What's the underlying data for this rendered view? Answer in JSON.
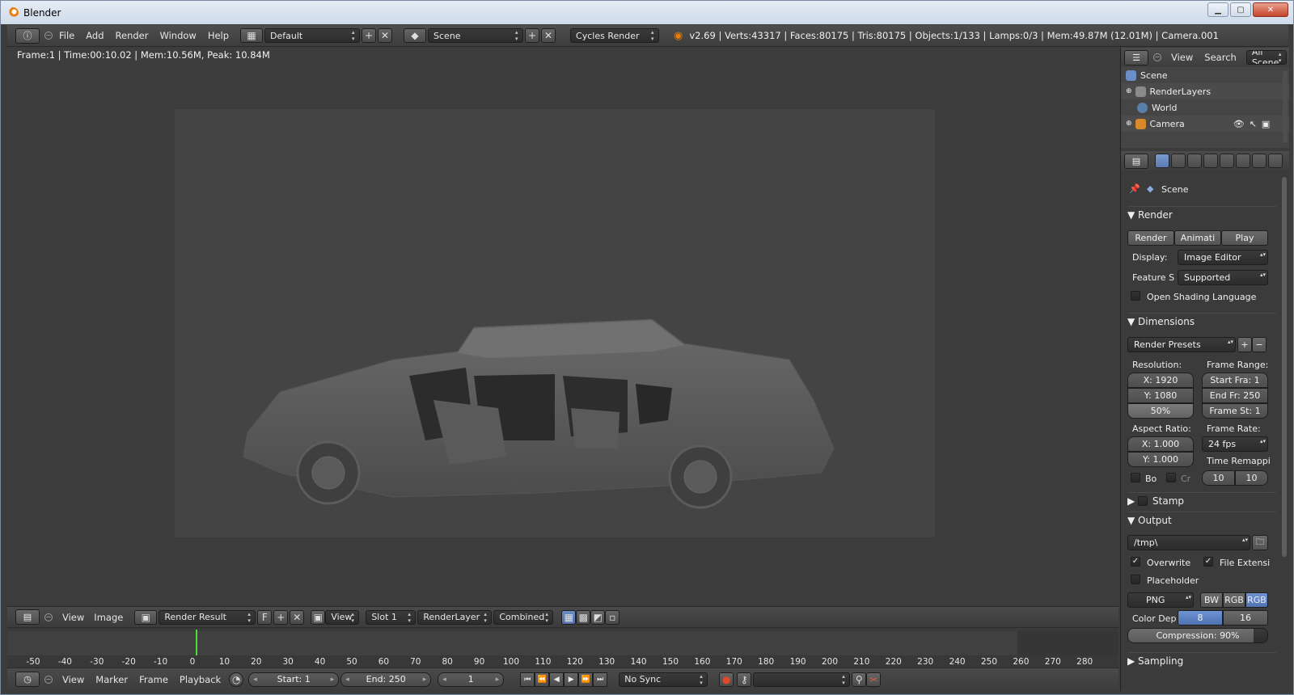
{
  "window": {
    "title": "Blender"
  },
  "top_header": {
    "menus": [
      "File",
      "Add",
      "Render",
      "Window",
      "Help"
    ],
    "screen_layout": "Default",
    "scene": "Scene",
    "engine": "Cycles Render",
    "stats": "v2.69 | Verts:43317 | Faces:80175 | Tris:80175 | Objects:1/133 | Lamps:0/3 | Mem:49.87M (12.01M) | Camera.001"
  },
  "viewport": {
    "info": "Frame:1 | Time:00:10.02 | Mem:10.56M, Peak: 10.84M"
  },
  "image_header": {
    "menus": [
      "View",
      "Image"
    ],
    "image_name": "Render Result",
    "fake_user": "F",
    "view_mode": "View",
    "slot": "Slot 1",
    "render_layer": "RenderLayer",
    "pass": "Combined"
  },
  "timeline": {
    "current_frame_value": 1,
    "ruler": [
      "-50",
      "-40",
      "-30",
      "-20",
      "-10",
      "0",
      "10",
      "20",
      "30",
      "40",
      "50",
      "60",
      "70",
      "80",
      "90",
      "100",
      "110",
      "120",
      "130",
      "140",
      "150",
      "160",
      "170",
      "180",
      "190",
      "200",
      "210",
      "220",
      "230",
      "240",
      "250",
      "260",
      "270",
      "280"
    ],
    "menus": [
      "View",
      "Marker",
      "Frame",
      "Playback"
    ],
    "start": "Start: 1",
    "end": "End: 250",
    "current": "1",
    "sync": "No Sync"
  },
  "outliner": {
    "menus": [
      "View",
      "Search"
    ],
    "filter": "All Scene",
    "items": [
      "Scene",
      "RenderLayers",
      "World",
      "Camera"
    ]
  },
  "properties": {
    "context": "Scene",
    "render": {
      "title": "Render",
      "buttons": [
        "Render",
        "Animati",
        "Play"
      ],
      "display_label": "Display:",
      "display_value": "Image Editor",
      "feature_label": "Feature S",
      "feature_value": "Supported",
      "osl_label": "Open Shading Language"
    },
    "dimensions": {
      "title": "Dimensions",
      "presets": "Render Presets",
      "resolution_label": "Resolution:",
      "res_x": "X: 1920",
      "res_y": "Y: 1080",
      "res_pct": "50%",
      "frame_range_label": "Frame Range:",
      "start": "Start Fra: 1",
      "end": "End Fr: 250",
      "step": "Frame St: 1",
      "aspect_label": "Aspect Ratio:",
      "asp_x": "X: 1.000",
      "asp_y": "Y: 1.000",
      "frame_rate_label": "Frame Rate:",
      "fps": "24 fps",
      "time_remap_label": "Time Remappi",
      "remap_old": "10",
      "remap_new": "10",
      "border_label": "Bo",
      "crop_label": "Cr"
    },
    "stamp": {
      "title": "Stamp"
    },
    "output": {
      "title": "Output",
      "path": "/tmp\\",
      "overwrite": "Overwrite",
      "file_ext": "File Extensi",
      "placeholder": "Placeholder",
      "format": "PNG",
      "bw": "BW",
      "rgb": "RGB",
      "rgba": "RGB",
      "color_depth_label": "Color Dep",
      "depth_8": "8",
      "depth_16": "16",
      "compression": "Compression: 90%"
    },
    "sampling": {
      "title": "Sampling"
    }
  }
}
